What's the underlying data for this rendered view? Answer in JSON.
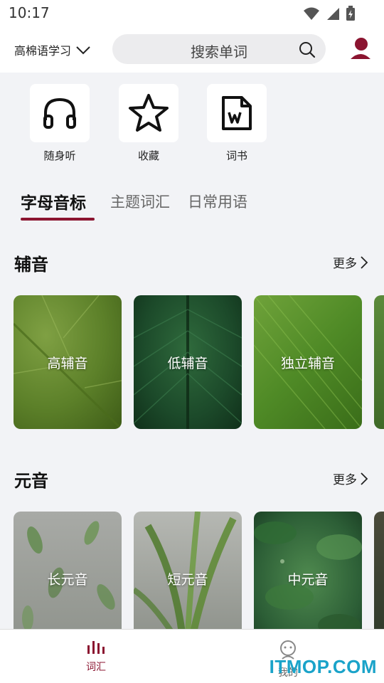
{
  "status_bar": {
    "time": "10:17"
  },
  "header": {
    "language": "高棉语学习",
    "search_placeholder": "搜索单词"
  },
  "shortcuts": [
    {
      "label": "随身听",
      "icon": "headphones-icon"
    },
    {
      "label": "收藏",
      "icon": "star-icon"
    },
    {
      "label": "词书",
      "icon": "word-document-icon"
    }
  ],
  "tabs": [
    {
      "label": "字母音标",
      "active": true
    },
    {
      "label": "主题词汇",
      "active": false
    },
    {
      "label": "日常用语",
      "active": false
    }
  ],
  "sections": {
    "consonants": {
      "title": "辅音",
      "more": "更多",
      "cards": [
        "高辅音",
        "低辅音",
        "独立辅音"
      ]
    },
    "vowels": {
      "title": "元音",
      "more": "更多",
      "cards": [
        "长元音",
        "短元音",
        "中元音"
      ]
    }
  },
  "bottom_nav": [
    {
      "label": "词汇",
      "active": true,
      "icon": "bars-icon"
    },
    {
      "label": "我的",
      "active": false,
      "icon": "robot-icon"
    }
  ],
  "watermark": "ITMOP.COM",
  "colors": {
    "accent": "#8b1430",
    "watermark": "#1aa3c9"
  }
}
